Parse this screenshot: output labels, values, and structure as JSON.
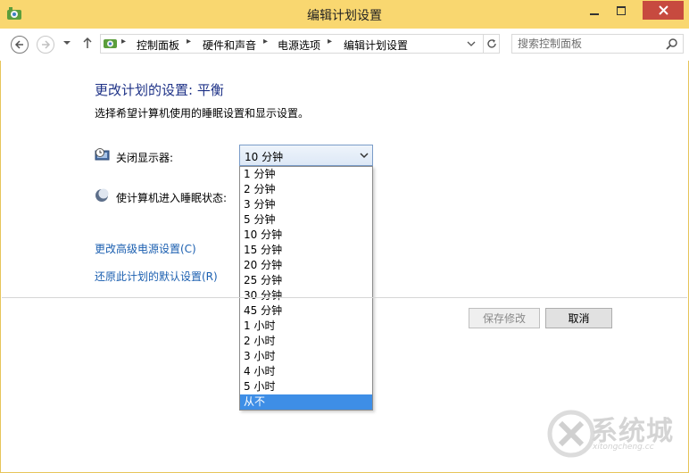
{
  "window": {
    "title": "编辑计划设置",
    "icons": {
      "app": "control-panel-icon",
      "minimize": "minimize-icon",
      "maximize": "maximize-icon",
      "close": "close-icon"
    }
  },
  "navbar": {
    "breadcrumbs": [
      "控制面板",
      "硬件和声音",
      "电源选项",
      "编辑计划设置"
    ],
    "search_placeholder": "搜索控制面板"
  },
  "content": {
    "heading": "更改计划的设置: 平衡",
    "subtitle": "选择希望计算机使用的睡眠设置和显示设置。",
    "display_off_label": "关闭显示器:",
    "sleep_label": "使计算机进入睡眠状态:",
    "display_off_value": "10 分钟",
    "dropdown_options": [
      "1 分钟",
      "2 分钟",
      "3 分钟",
      "5 分钟",
      "10 分钟",
      "15 分钟",
      "20 分钟",
      "25 分钟",
      "30 分钟",
      "45 分钟",
      "1 小时",
      "2 小时",
      "3 小时",
      "4 小时",
      "5 小时",
      "从不"
    ],
    "highlighted_option": "从不",
    "link_advanced": "更改高级电源设置(C)",
    "link_restore": "还原此计划的默认设置(R)"
  },
  "buttons": {
    "save": "保存修改",
    "cancel": "取消"
  },
  "watermark": {
    "brand": "系统城",
    "url": "xitongcheng.cc"
  },
  "colors": {
    "titlebar": "#f9d770",
    "heading": "#1e3287",
    "link": "#1b5fb0",
    "selection": "#3e8ee6",
    "close_button": "#c74a3f"
  }
}
